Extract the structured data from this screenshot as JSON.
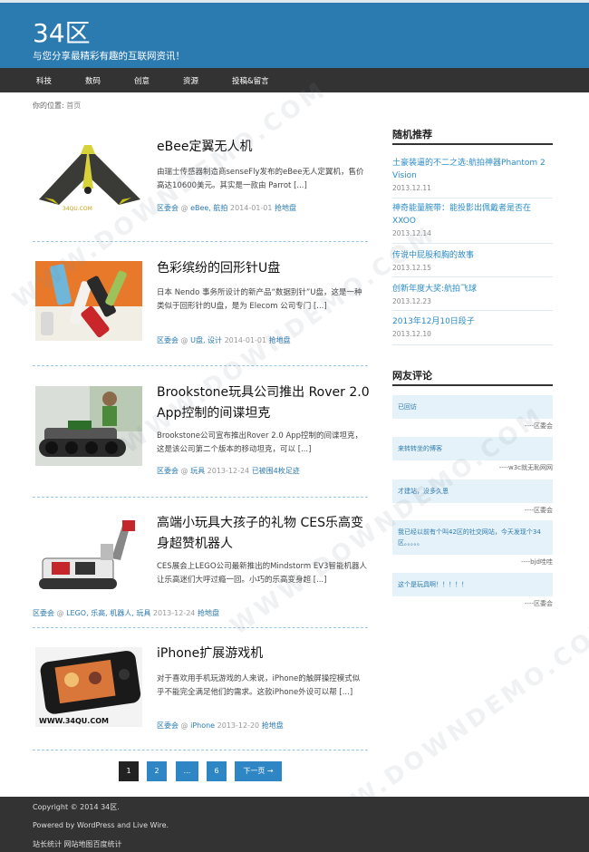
{
  "site": {
    "title": "34区",
    "description": "与您分享最精彩有趣的互联网资讯！"
  },
  "nav": {
    "items": [
      {
        "label": "科技"
      },
      {
        "label": "数码"
      },
      {
        "label": "创意"
      },
      {
        "label": "资源"
      },
      {
        "label": "投稿&留言"
      }
    ]
  },
  "breadcrumb": {
    "prefix": "你的位置:",
    "home": "首页"
  },
  "posts": [
    {
      "title": "eBee定翼无人机",
      "excerpt": "由瑞士传感器制造商senseFly发布的eBee无人定翼机，售价高达10600美元。其实是一款由 Parrot [...]",
      "author": "区委会",
      "at": "@",
      "cats": "eBee, 航拍",
      "date": "2014-01-01",
      "comment_link": "抢地盘",
      "thumb_caption": "34QU.COM"
    },
    {
      "title": "色彩缤纷的回形针U盘",
      "excerpt": "日本 Nendo 事务所设计的新产品“数据别针”U盘，这是一种类似于回形针的U盘，是为 Elecom 公司专门 [...]",
      "author": "区委会",
      "at": "@",
      "cats": "U盘, 设计",
      "date": "2014-01-01",
      "comment_link": "抢地盘"
    },
    {
      "title": "Brookstone玩具公司推出 Rover 2.0 App控制的间谍坦克",
      "excerpt": "Brookstone公司宣布推出Rover 2.0 App控制的间谍坦克，这是该公司第二个版本的移动坦克，可以 [...]",
      "author": "区委会",
      "at": "@",
      "cats": "玩具",
      "date": "2013-12-24",
      "comment_link": "已被围4枚足迹"
    },
    {
      "title": "高端小玩具大孩子的礼物 CES乐高变身超赞机器人",
      "excerpt": "CES展会上LEGO公司最新推出的Mindstorm EV3智能机器人让乐高迷们大呼过瘾一回。小巧的乐高变身超 [...]",
      "author": "区委会",
      "at": "@",
      "cats": "LEGO, 乐高, 机器人, 玩具",
      "date": "2013-12-24",
      "comment_link": "抢地盘"
    },
    {
      "title": "iPhone扩展游戏机",
      "excerpt": "对于喜欢用手机玩游戏的人来说，iPhone的触屏操控模式似乎不能完全满足他们的需求。这款iPhone外设可以帮 [...]",
      "author": "区委会",
      "at": "@",
      "cats": "iPhone",
      "date": "2013-12-20",
      "comment_link": "抢地盘",
      "thumb_caption": "WWW.34QU.COM"
    }
  ],
  "pagination": {
    "pages": [
      "1",
      "2",
      "...",
      "6"
    ],
    "next": "下一页 →",
    "current": "1"
  },
  "sidebar": {
    "recommend_title": "随机推荐",
    "recommend": [
      {
        "title": "土豪装逼的不二之选:航拍神器Phantom 2 Vision",
        "date": "2013.12.11"
      },
      {
        "title": "神奇能量腕带：能投影出佩戴者是否在XXOO",
        "date": "2013.12.14"
      },
      {
        "title": "传说中屁股和胸的故事",
        "date": "2013.12.15"
      },
      {
        "title": "创新年度大奖:航拍飞球",
        "date": "2013.12.23"
      },
      {
        "title": "2013年12月10日段子",
        "date": "2013.12.10"
      }
    ],
    "comments_title": "网友评论",
    "comments": [
      {
        "text": "已回访",
        "author": "----区委会"
      },
      {
        "text": "来转转坐的博客",
        "author": "----w3c就无恥网网"
      },
      {
        "text": "才建站，没多久恩",
        "author": "----区委会"
      },
      {
        "text": "我已经以前有个叫42区的社交网站，今天发现个34区。。。。。",
        "author": "----bjd哇哇"
      },
      {
        "text": "这个是玩具啊！！！！！",
        "author": "----区委会"
      }
    ]
  },
  "footer": {
    "copyright": "Copyright © 2014 34区.",
    "powered": "Powered by WordPress and Live Wire.",
    "links": "站长统计 网站地图百度统计"
  },
  "watermark": "WWW.DOWNDEMO.COM",
  "colors": {
    "header": "#2b7ab0",
    "nav": "#333333",
    "link": "#2b8bc9",
    "page_button": "#2f86c5",
    "comment_bg": "#e6f2f9"
  }
}
